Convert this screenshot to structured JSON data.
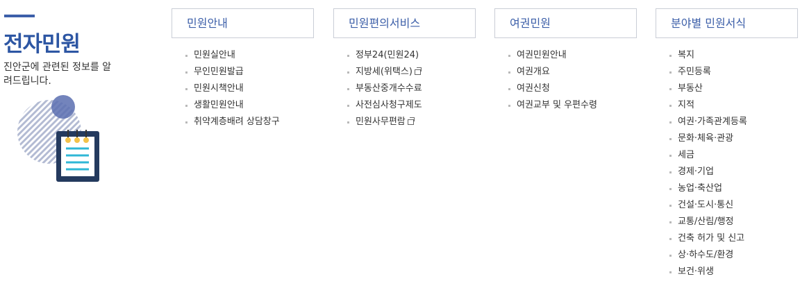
{
  "sidebar": {
    "title": "전자민원",
    "description": "진안군에 관련된 정보를 알려드립니다."
  },
  "columns": [
    {
      "heading": "민원안내",
      "items": [
        {
          "label": "민원실안내",
          "external": false
        },
        {
          "label": "무인민원발급",
          "external": false
        },
        {
          "label": "민원시책안내",
          "external": false
        },
        {
          "label": "생활민원안내",
          "external": false
        },
        {
          "label": "취약계층배려 상담창구",
          "external": false
        }
      ]
    },
    {
      "heading": "민원편의서비스",
      "items": [
        {
          "label": "정부24(민원24)",
          "external": false
        },
        {
          "label": "지방세(위택스)",
          "external": true
        },
        {
          "label": "부동산중개수수료",
          "external": false
        },
        {
          "label": "사전심사청구제도",
          "external": false
        },
        {
          "label": "민원사무편람",
          "external": true
        }
      ]
    },
    {
      "heading": "여권민원",
      "items": [
        {
          "label": "여권민원안내",
          "external": false
        },
        {
          "label": "여권개요",
          "external": false
        },
        {
          "label": "여권신청",
          "external": false
        },
        {
          "label": "여권교부 및 우편수령",
          "external": false
        }
      ]
    },
    {
      "heading": "분야별 민원서식",
      "items": [
        {
          "label": "복지",
          "external": false
        },
        {
          "label": "주민등록",
          "external": false
        },
        {
          "label": "부동산",
          "external": false
        },
        {
          "label": "지적",
          "external": false
        },
        {
          "label": "여권·가족관계등록",
          "external": false
        },
        {
          "label": "문화·체육·관광",
          "external": false
        },
        {
          "label": "세금",
          "external": false
        },
        {
          "label": "경제·기업",
          "external": false
        },
        {
          "label": "농업·축산업",
          "external": false
        },
        {
          "label": "건설·도시·통신",
          "external": false
        },
        {
          "label": "교통/산림/행정",
          "external": false
        },
        {
          "label": "건축 허가 및 신고",
          "external": false
        },
        {
          "label": "상·하수도/환경",
          "external": false
        },
        {
          "label": "보건·위생",
          "external": false
        }
      ]
    }
  ],
  "colors": {
    "accent": "#2d56a3",
    "heading_text": "#3b5ea8",
    "border": "#c9cdd6",
    "bullet": "#b9b9b9"
  },
  "icons": {
    "illustration": "notepad-icon",
    "external_link": "new-window-icon"
  }
}
